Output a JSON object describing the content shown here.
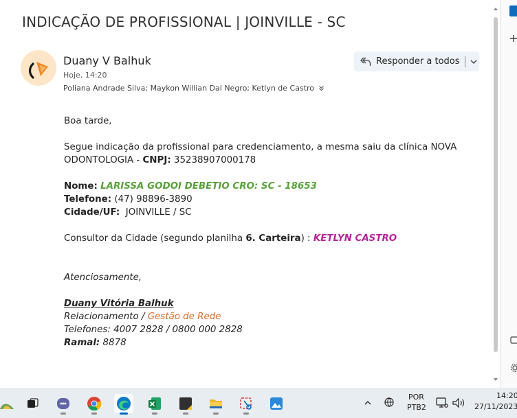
{
  "email": {
    "subject": "INDICAÇÃO DE PROFISSIONAL | JOINVILLE - SC",
    "sender_name": "Duany V Balhuk",
    "date": "Hoje, 14:20",
    "recipients": "Poliana Andrade Silva; Maykon Willian Dal Negro; Ketlyn de Castro",
    "reply_all_label": "Responder a todos",
    "body": {
      "greeting": "Boa tarde,",
      "intro": "Segue indicação da profissional para credenciamento, a mesma saiu da clínica NOVA ODONTOLOGIA - ",
      "cnpj_label": "CNPJ:",
      "cnpj_value": " 35238907000178",
      "nome_label": "Nome:",
      "nome_value": "LARISSA GODOI DEBETIO CRO: SC - 18653",
      "telefone_label": "Telefone:",
      "telefone_value": " (47) 98896-3890",
      "cidade_label": "Cidade/UF:",
      "cidade_value": "  JOINVILLE / SC",
      "consultor_prefix": "Consultor da Cidade (segundo planilha ",
      "consultor_sheet": "6. Carteira",
      "consultor_suffix": ") : ",
      "consultor_name": "KETLYN CASTRO",
      "closing": "Atenciosamente,",
      "sig_name": "Duany Vitória Balhuk ",
      "sig_dept_a": "Relacionamento / ",
      "sig_dept_b": "Gestão de Rede",
      "sig_phones": "Telefones: 4007 2828 / 0800 000 2828",
      "sig_ramal_label": "Ramal:",
      "sig_ramal_value": " 8878"
    }
  },
  "taskbar": {
    "apps": [
      "widgets-icon",
      "task-view-icon",
      "teams-icon",
      "chrome-icon",
      "edge-icon",
      "excel-icon",
      "sticky-notes-icon",
      "file-explorer-icon",
      "snipping-tool-icon",
      "photos-icon"
    ],
    "lang_line1": "POR",
    "lang_line2": "PTB2",
    "clock_time": "14:20",
    "clock_date": "27/11/2023"
  },
  "colors": {
    "accent": "#0067c0",
    "green": "#58a13a",
    "purple": "#b6239a",
    "orange": "#d86a28"
  }
}
